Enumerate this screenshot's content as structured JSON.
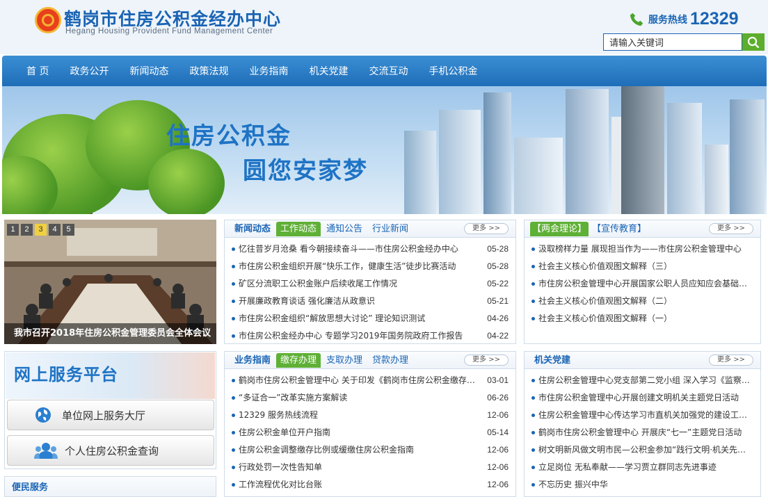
{
  "header": {
    "title_cn": "鹤岗市住房公积金经办中心",
    "title_en": "Hegang Housing Provident Fund Management Center",
    "hotline_label": "服务热线",
    "hotline_number": "12329",
    "search_placeholder": "请输入关键词"
  },
  "nav": [
    "首 页",
    "政务公开",
    "新闻动态",
    "政策法规",
    "业务指南",
    "机关党建",
    "交流互动",
    "手机公积金"
  ],
  "banner": {
    "line1": "住房公积金",
    "line2": "圆您安家梦"
  },
  "slideshow": {
    "pages": [
      "1",
      "2",
      "3",
      "4",
      "5"
    ],
    "active_page": 3,
    "caption": "我市召开2018年住房公积金管理委员会全体会议"
  },
  "news_panel": {
    "tabs": [
      "新闻动态",
      "工作动态",
      "通知公告",
      "行业新闻"
    ],
    "active_tab": "工作动态",
    "more": "更多 >>",
    "items": [
      {
        "title": "忆往昔岁月沧桑 看今朝接续奋斗——市住房公积金经办中心",
        "date": "05-28"
      },
      {
        "title": "市住房公积金组织开展“快乐工作，健康生活”徒步比赛活动",
        "date": "05-28"
      },
      {
        "title": "矿区分流职工公积金账户后续收尾工作情况",
        "date": "05-22"
      },
      {
        "title": "开展廉政教育谈话 强化廉洁从政意识",
        "date": "05-21"
      },
      {
        "title": "市住房公积金组织“解放思想大讨论” 理论知识测试",
        "date": "04-26"
      },
      {
        "title": "市住房公积金经办中心 专题学习2019年国务院政府工作报告",
        "date": "04-22"
      }
    ]
  },
  "theory_panel": {
    "tabs": [
      "【两会理论】",
      "【宣传教育】"
    ],
    "more": "更多 >>",
    "items": [
      {
        "title": "汲取榜样力量 展现担当作为——市住房公积金管理中心"
      },
      {
        "title": "社会主义核心价值观图文解释（三）"
      },
      {
        "title": "市住房公积金管理中心开展国家公职人员应知应会基础知识测试"
      },
      {
        "title": "社会主义核心价值观图文解释（二）"
      },
      {
        "title": "社会主义核心价值观图文解释（一）"
      }
    ]
  },
  "service_platform": {
    "title": "网上服务平台",
    "unit_hall": "单位网上服务大厅",
    "personal_query": "个人住房公积金查询"
  },
  "convenience": {
    "title": "便民服务"
  },
  "guide_panel": {
    "tabs": [
      "业务指南",
      "缴存办理",
      "支取办理",
      "贷款办理"
    ],
    "active_tab": "缴存办理",
    "more": "更多 >>",
    "items": [
      {
        "title": "鹤岗市住房公积金管理中心 关于印发《鹤岗市住房公积金缴存管理办法》",
        "date": "03-01"
      },
      {
        "title": "“多证合一”改革实施方案解读",
        "date": "06-26"
      },
      {
        "title": "12329 服务热线流程",
        "date": "12-06"
      },
      {
        "title": "住房公积金单位开户指南",
        "date": "05-14"
      },
      {
        "title": "住房公积金调整缴存比例或缓缴住房公积金指南",
        "date": "12-06"
      },
      {
        "title": "行政处罚一次性告知单",
        "date": "12-06"
      },
      {
        "title": "工作流程优化对比台账",
        "date": "12-06"
      }
    ]
  },
  "party_panel": {
    "tabs": [
      "机关党建"
    ],
    "more": "更多 >>",
    "items": [
      {
        "title": "住房公积金管理中心党支部第二党小组 深入学习《监察法》"
      },
      {
        "title": "市住房公积金管理中心开展创建文明机关主题党日活动"
      },
      {
        "title": "住房公积金管理中心传达学习市直机关加强党的建设工作会议精神"
      },
      {
        "title": "鹤岗市住房公积金管理中心 开展庆“七一”主题党日活动"
      },
      {
        "title": "树文明新风做文明市民—公积金参加“践行文明·机关先行”活动"
      },
      {
        "title": "立足岗位 无私奉献——学习贾立群同志先进事迹"
      },
      {
        "title": "不忘历史 振兴中华"
      }
    ]
  },
  "colors": {
    "brand_blue": "#1a64b4",
    "nav_blue": "#2a7dc6",
    "accent_green": "#5fb036"
  }
}
